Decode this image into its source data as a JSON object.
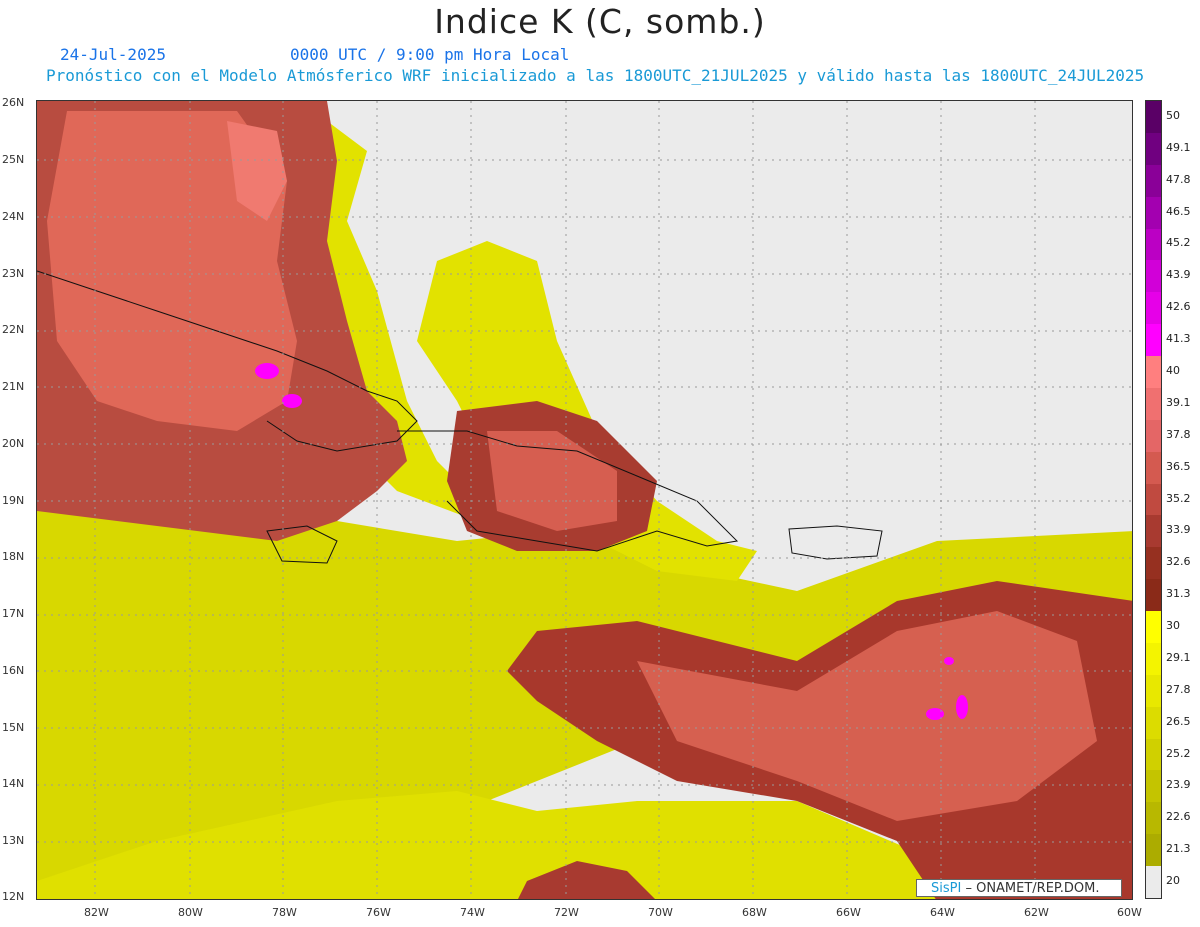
{
  "title": "Indice K (C, somb.)",
  "date_label": "24-Jul-2025",
  "time_label": "0000 UTC / 9:00 pm Hora Local",
  "description": "Pronóstico con el Modelo Atmósferico WRF inicializado a las 1800UTC_21JUL2025 y válido hasta las  1800UTC_24JUL2025",
  "lat_labels": [
    "26N",
    "25N",
    "24N",
    "23N",
    "22N",
    "21N",
    "20N",
    "19N",
    "18N",
    "17N",
    "16N",
    "15N",
    "14N",
    "13N",
    "12N"
  ],
  "lon_labels": [
    "82W",
    "80W",
    "78W",
    "76W",
    "74W",
    "72W",
    "70W",
    "68W",
    "66W",
    "64W",
    "62W",
    "60W"
  ],
  "colorbar": {
    "levels": [
      "50",
      "49.1",
      "47.8",
      "46.5",
      "45.2",
      "43.9",
      "42.6",
      "41.3",
      "40",
      "39.1",
      "37.8",
      "36.5",
      "35.2",
      "33.9",
      "32.6",
      "31.3",
      "30",
      "29.1",
      "27.8",
      "26.5",
      "25.2",
      "23.9",
      "22.6",
      "21.3",
      "20"
    ],
    "colors": [
      "#5a0066",
      "#700080",
      "#8a0098",
      "#a300b0",
      "#bb00c4",
      "#d100d8",
      "#e600e8",
      "#ff00ff",
      "#ff7f7f",
      "#f07070",
      "#e46666",
      "#d45a50",
      "#c04a40",
      "#a83a30",
      "#963020",
      "#8a2a18",
      "#ffff00",
      "#f4f400",
      "#e8e800",
      "#dcdc00",
      "#d0d000",
      "#c4c400",
      "#b8b800",
      "#acac00",
      "#ebebeb"
    ]
  },
  "credit": {
    "logo": "SisPI",
    "text": "– ONAMET/REP.DOM."
  }
}
